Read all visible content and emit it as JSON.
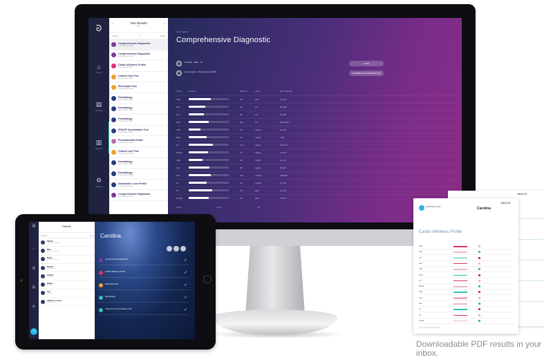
{
  "desktop": {
    "rail": {
      "logo": "ᘐ",
      "items": [
        {
          "glyph": "⌂",
          "label": "Home"
        },
        {
          "glyph": "▤",
          "label": "Results"
        },
        {
          "glyph": "▥",
          "label": "Reports"
        },
        {
          "glyph": "⚙",
          "label": "Settings"
        }
      ]
    },
    "list": {
      "title": "Test Results",
      "dots": "• •",
      "search_placeholder": "Search",
      "filter": "∨",
      "sort": "Latest",
      "items": [
        {
          "name": "Comprehensive Diagnostic",
          "sub": "Lorem ipsum dolor",
          "color": "#7a3a9a"
        },
        {
          "name": "Comprehensive Diagnostic",
          "sub": "Lorem ipsum dolor",
          "color": "#7a3a9a"
        },
        {
          "name": "Cardio Wellness Profile",
          "sub": "Lorem ipsum dolor",
          "color": "#e0306a"
        },
        {
          "name": "Critical Care Plus",
          "sub": "Lorem ipsum dolor",
          "color": "#f0a02a"
        },
        {
          "name": "Electrolyte Plus",
          "sub": "Lorem ipsum dolor",
          "color": "#f0a02a"
        },
        {
          "name": "Hematology",
          "sub": "Lorem ipsum dolor",
          "color": "#2a3d7a"
        },
        {
          "name": "Hematology",
          "sub": "Lorem ipsum dolor",
          "color": "#2a3d7a"
        },
        {
          "name": "Hematology",
          "sub": "Lorem ipsum dolor",
          "color": "#2a3d7a"
        },
        {
          "name": "IPSATP Combination Test",
          "sub": "Lorem ipsum dolor",
          "color": "#2a3d7a"
        },
        {
          "name": "Phenobarbital Profile",
          "sub": "Lorem ipsum dolor",
          "color": "#c46aa6"
        },
        {
          "name": "Critical Care Plus",
          "sub": "Lorem ipsum dolor",
          "color": "#f0a02a"
        },
        {
          "name": "Hematology",
          "sub": "Lorem ipsum dolor",
          "color": "#2a3d7a"
        },
        {
          "name": "Hematology",
          "sub": "Lorem ipsum dolor",
          "color": "#2a3d7a"
        },
        {
          "name": "Nonemaker Liver Profile",
          "sub": "Lorem ipsum dolor",
          "color": "#2a3d7a"
        },
        {
          "name": "Comprehensive Diagnostic",
          "sub": "Lorem ipsum dolor",
          "color": "#7a3a9a"
        }
      ]
    },
    "main": {
      "supertitle": "Lorem ipsum",
      "title": "Comprehensive Diagnostic",
      "info1": "Carolina · Male · 5y",
      "info2": "Lorem ipsum · Sample date 1/2/16",
      "pill1": "● PDF",
      "pill2": "● DOWNLOAD PDF RESULTS",
      "cols": [
        "TEST",
        "RANGE",
        "RESULT",
        "UNIT",
        "REF. RANGE"
      ],
      "rows": [
        {
          "code": "ALB",
          "fill": 0.55,
          "result": "3.5",
          "unit": "g/dL",
          "ref": "2.5-3.9"
        },
        {
          "code": "ALP",
          "fill": 0.42,
          "result": "41",
          "unit": "U/L",
          "ref": "20-150"
        },
        {
          "code": "ALT",
          "fill": 0.38,
          "result": "58",
          "unit": "U/L",
          "ref": "10-118"
        },
        {
          "code": "AMY",
          "fill": 0.5,
          "result": "633",
          "unit": "U/L",
          "ref": "200-1200"
        },
        {
          "code": "TBIL",
          "fill": 0.3,
          "result": "0.2",
          "unit": "mg/dL",
          "ref": "0.1-0.6"
        },
        {
          "code": "BUN",
          "fill": 0.45,
          "result": "15",
          "unit": "mg/dL",
          "ref": "7-25"
        },
        {
          "code": "CA",
          "fill": 0.6,
          "result": "10.1",
          "unit": "mg/dL",
          "ref": "8.6-11.8"
        },
        {
          "code": "PHOS",
          "fill": 0.48,
          "result": "4.3",
          "unit": "mg/dL",
          "ref": "2.9-6.6"
        },
        {
          "code": "CRE",
          "fill": 0.35,
          "result": "0.9",
          "unit": "mg/dL",
          "ref": "0.3-1.4"
        },
        {
          "code": "GLU",
          "fill": 0.52,
          "result": "98",
          "unit": "mg/dL",
          "ref": "60-110"
        },
        {
          "code": "NA+",
          "fill": 0.56,
          "result": "146",
          "unit": "mmol/L",
          "ref": "138-160"
        },
        {
          "code": "K+",
          "fill": 0.44,
          "result": "4.4",
          "unit": "mmol/L",
          "ref": "3.7-5.8"
        },
        {
          "code": "TP",
          "fill": 0.58,
          "result": "6.9",
          "unit": "g/dL",
          "ref": "5.4-8.2"
        },
        {
          "code": "GLOB",
          "fill": 0.5,
          "result": "3.4",
          "unit": "g/dL",
          "ref": "2.3-5.2"
        }
      ],
      "foot_left": "HIGH",
      "foot_mid": "LOW",
      "foot_right": "N/T"
    }
  },
  "tablet": {
    "list_title": "Patients",
    "search": "Search",
    "sort": "A-Z",
    "items": [
      {
        "name": "Tiffany",
        "sub": "Labrador Retriever"
      },
      {
        "name": "Max",
        "sub": "Domestic Shorthair"
      },
      {
        "name": "Molly",
        "sub": "Golden Retriever"
      },
      {
        "name": "Bandit",
        "sub": "Mixed Breed"
      },
      {
        "name": "Charlie",
        "sub": "Beagle"
      },
      {
        "name": "Bailey",
        "sub": "Poodle"
      },
      {
        "name": "Lily",
        "sub": "Siamese"
      },
      {
        "name": "Jefferson Jones",
        "sub": "Dachshund"
      }
    ],
    "detail_title": "Carolina",
    "results": [
      {
        "name": "Comprehensive Diagnostic",
        "color": "#7a3a9a"
      },
      {
        "name": "Cardio Wellness Profile",
        "color": "#e0306a"
      },
      {
        "name": "Electrolyte Plus",
        "color": "#f0a02a"
      },
      {
        "name": "Hematology",
        "color": "#2cc2b3"
      },
      {
        "name": "Thyroxine T4 Combination Test",
        "color": "#2cc2b3"
      }
    ],
    "check": "✓"
  },
  "pdf": {
    "clinic": "Veterinary Clinic",
    "patient": "Carolina",
    "brand": "ABAXIS",
    "report_title": "Cardio Wellness Profile",
    "rows": [
      "ALB",
      "ALP",
      "ALT",
      "AMY",
      "TBIL",
      "BUN",
      "CA",
      "PHOS",
      "CRE",
      "GLU",
      "NA+",
      "K+",
      "TP",
      "GLOB"
    ],
    "footer": "Lorem ipsum dolor sit amet"
  },
  "caption": "Downloadable PDF results in your inbox."
}
